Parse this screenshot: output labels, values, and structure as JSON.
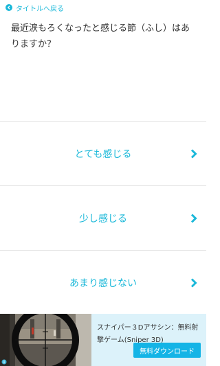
{
  "header": {
    "back_label": "タイトルへ戻る",
    "back_icon": "chevron-left-circle-icon"
  },
  "question": {
    "text": "最近涙もろくなったと感じる節（ふし）はありますか？"
  },
  "answers": [
    {
      "label": "とても感じる"
    },
    {
      "label": "少し感じる"
    },
    {
      "label": "あまり感じない"
    }
  ],
  "ad": {
    "title": "スナイパー３Dアサシン：無料射撃ゲーム(Sniper 3D)",
    "cta_label": "無料ダウンロード",
    "image": "sniper-scope-game-screenshot"
  },
  "colors": {
    "accent": "#1ab8d9",
    "text": "#333333",
    "divider": "#e3e3e3",
    "ad_background": "#dcf2fa",
    "cta": "#14b4e6"
  }
}
